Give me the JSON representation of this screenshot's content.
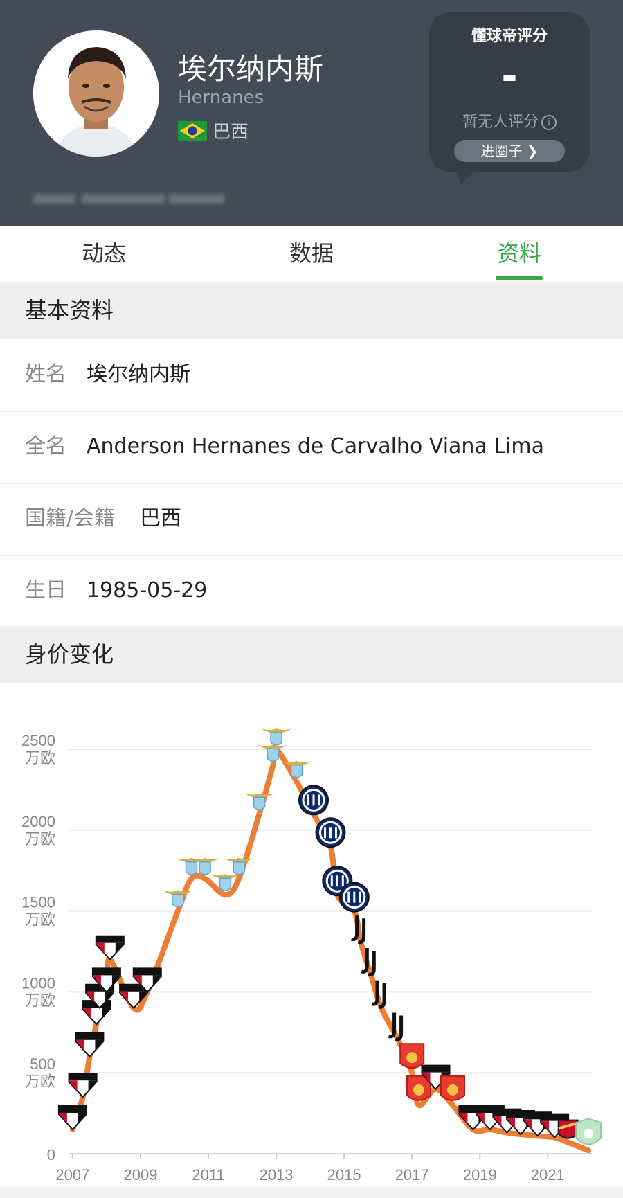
{
  "header": {
    "name": "埃尔纳内斯",
    "name_en": "Hernanes",
    "nationality": "巴西",
    "rating": {
      "title": "懂球帝评分",
      "value": "-",
      "status": "暂无人评分",
      "info_icon": "i",
      "circle_button": "进圈子 ❯"
    },
    "colors": {
      "background": "#434b56",
      "card": "#363d47"
    }
  },
  "tabs": [
    {
      "label": "动态"
    },
    {
      "label": "数据"
    },
    {
      "label": "资料",
      "active": true
    }
  ],
  "accent_color": "#3aa64a",
  "basic_info": {
    "title": "基本资料",
    "rows": [
      {
        "label": "姓名",
        "value": "埃尔纳内斯"
      },
      {
        "label": "全名",
        "value": "Anderson Hernanes de Carvalho Viana Lima"
      },
      {
        "label": "国籍/会籍",
        "value": "巴西"
      },
      {
        "label": "生日",
        "value": "1985-05-29"
      }
    ]
  },
  "value_section": {
    "title": "身价变化"
  },
  "chart_data": {
    "type": "line",
    "unit": "万欧",
    "line_color": "#ee7d35",
    "ylim": [
      0,
      2500
    ],
    "xlim": [
      2006.9,
      2022.3
    ],
    "y_ticks": [
      {
        "value": 2500,
        "num": "2500",
        "unit": "万欧"
      },
      {
        "value": 2000,
        "num": "2000",
        "unit": "万欧"
      },
      {
        "value": 1500,
        "num": "1500",
        "unit": "万欧"
      },
      {
        "value": 1000,
        "num": "1000",
        "unit": "万欧"
      },
      {
        "value": 500,
        "num": "500",
        "unit": "万欧"
      },
      {
        "value": 0,
        "num": "0",
        "unit": ""
      }
    ],
    "x_ticks": [
      "2007",
      "2009",
      "2011",
      "2013",
      "2015",
      "2017",
      "2019",
      "2021"
    ],
    "grid": true,
    "points": [
      {
        "x": 2007.0,
        "y": 150,
        "club": "São Paulo",
        "badge": "SPFC"
      },
      {
        "x": 2007.3,
        "y": 350,
        "club": "São Paulo",
        "badge": "SPFC"
      },
      {
        "x": 2007.5,
        "y": 600,
        "club": "São Paulo",
        "badge": "SPFC"
      },
      {
        "x": 2007.7,
        "y": 800,
        "club": "São Paulo",
        "badge": "SPFC"
      },
      {
        "x": 2007.8,
        "y": 900,
        "club": "São Paulo",
        "badge": "SPFC"
      },
      {
        "x": 2008.0,
        "y": 1000,
        "club": "São Paulo",
        "badge": "SPFC"
      },
      {
        "x": 2008.1,
        "y": 1200,
        "club": "São Paulo",
        "badge": "SPFC"
      },
      {
        "x": 2008.8,
        "y": 900,
        "club": "São Paulo",
        "badge": "SPFC"
      },
      {
        "x": 2009.2,
        "y": 1000,
        "club": "São Paulo",
        "badge": "SPFC"
      },
      {
        "x": 2010.1,
        "y": 1500,
        "club": "Lazio",
        "badge": "Lazio"
      },
      {
        "x": 2010.5,
        "y": 1700,
        "club": "Lazio",
        "badge": "Lazio"
      },
      {
        "x": 2010.9,
        "y": 1700,
        "club": "Lazio",
        "badge": "Lazio"
      },
      {
        "x": 2011.5,
        "y": 1600,
        "club": "Lazio",
        "badge": "Lazio"
      },
      {
        "x": 2011.9,
        "y": 1700,
        "club": "Lazio",
        "badge": "Lazio"
      },
      {
        "x": 2012.5,
        "y": 2100,
        "club": "Lazio",
        "badge": "Lazio"
      },
      {
        "x": 2012.9,
        "y": 2400,
        "club": "Lazio",
        "badge": "Lazio"
      },
      {
        "x": 2013.0,
        "y": 2500,
        "club": "Lazio",
        "badge": "Lazio"
      },
      {
        "x": 2013.6,
        "y": 2300,
        "club": "Lazio",
        "badge": "Lazio"
      },
      {
        "x": 2014.1,
        "y": 2100,
        "club": "Inter",
        "badge": "Inter"
      },
      {
        "x": 2014.6,
        "y": 1900,
        "club": "Inter",
        "badge": "Inter"
      },
      {
        "x": 2014.8,
        "y": 1600,
        "club": "Inter",
        "badge": "Inter"
      },
      {
        "x": 2015.3,
        "y": 1500,
        "club": "Inter",
        "badge": "Inter"
      },
      {
        "x": 2015.5,
        "y": 1300,
        "club": "Juventus",
        "badge": "Juventus"
      },
      {
        "x": 2015.8,
        "y": 1100,
        "club": "Juventus",
        "badge": "Juventus"
      },
      {
        "x": 2016.1,
        "y": 900,
        "club": "Juventus",
        "badge": "Juventus"
      },
      {
        "x": 2016.6,
        "y": 700,
        "club": "Juventus",
        "badge": "Juventus"
      },
      {
        "x": 2017.0,
        "y": 500,
        "club": "Hebei",
        "badge": "HEBFC"
      },
      {
        "x": 2017.2,
        "y": 300,
        "club": "Hebei",
        "badge": "HEBFC"
      },
      {
        "x": 2017.7,
        "y": 400,
        "club": "São Paulo",
        "badge": "SPFC"
      },
      {
        "x": 2018.2,
        "y": 300,
        "club": "Hebei",
        "badge": "HEBFC"
      },
      {
        "x": 2018.8,
        "y": 150,
        "club": "São Paulo",
        "badge": "SPFC"
      },
      {
        "x": 2019.3,
        "y": 150,
        "club": "São Paulo",
        "badge": "SPFC"
      },
      {
        "x": 2019.8,
        "y": 130,
        "club": "São Paulo",
        "badge": "SPFC"
      },
      {
        "x": 2020.2,
        "y": 120,
        "club": "São Paulo",
        "badge": "SPFC"
      },
      {
        "x": 2020.7,
        "y": 110,
        "club": "São Paulo",
        "badge": "SPFC"
      },
      {
        "x": 2021.2,
        "y": 100,
        "club": "São Paulo",
        "badge": "SPFC"
      },
      {
        "x": 2021.6,
        "y": 70,
        "club": "Sport Recife",
        "badge": "Sport"
      },
      {
        "x": 2022.2,
        "y": 20,
        "club": "",
        "badge": "Shield"
      }
    ]
  }
}
